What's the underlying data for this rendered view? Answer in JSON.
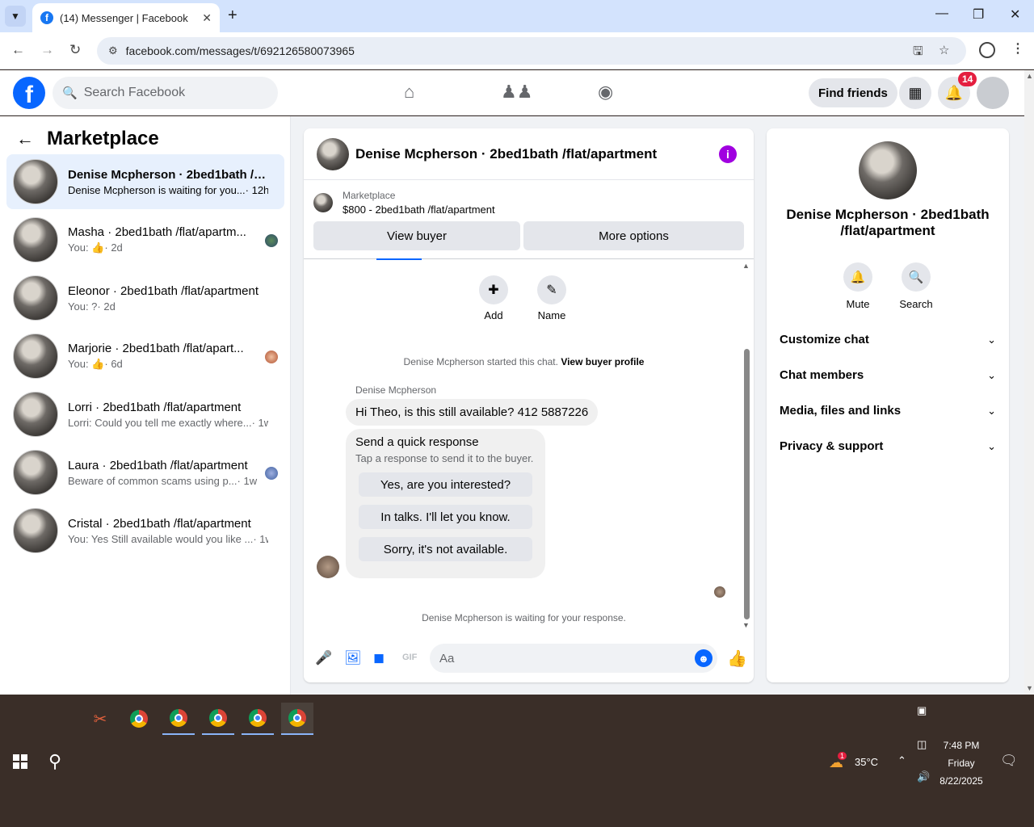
{
  "browser": {
    "tab_title": "(14) Messenger | Facebook",
    "url": "facebook.com/messages/t/692126580073965"
  },
  "fb": {
    "search_placeholder": "Search Facebook",
    "find_friends": "Find friends",
    "notification_count": "14"
  },
  "left": {
    "title": "Marketplace",
    "conversations": [
      {
        "name": "Denise Mcpherson · 2bed1bath /fl...",
        "preview": "Denise Mcpherson is waiting for you...",
        "time": "· 12h",
        "active": true
      },
      {
        "name": "Masha · 2bed1bath /flat/apartm...",
        "preview": "You:",
        "time": "· 2d",
        "like": true
      },
      {
        "name": "Eleonor · 2bed1bath /flat/apartment",
        "preview": "You: ?",
        "time": "· 2d"
      },
      {
        "name": "Marjorie · 2bed1bath /flat/apart...",
        "preview": "You:",
        "time": "· 6d",
        "like": true
      },
      {
        "name": "Lorri · 2bed1bath /flat/apartment",
        "preview": "Lorri: Could you tell me exactly where...",
        "time": "· 1w"
      },
      {
        "name": "Laura · 2bed1bath /flat/apartment",
        "preview": "Beware of common scams using p...",
        "time": "· 1w"
      },
      {
        "name": "Cristal · 2bed1bath /flat/apartment",
        "preview": "You: Yes Still available would you like ...",
        "time": "· 1w"
      }
    ]
  },
  "chat": {
    "title": "Denise Mcpherson · 2bed1bath /flat/apartment",
    "marketplace_label": "Marketplace",
    "listing": "$800 - 2bed1bath /flat/apartment",
    "view_buyer": "View buyer",
    "more_options": "More options",
    "add_label": "Add",
    "name_label": "Name",
    "started_text": "Denise Mcpherson started this chat.",
    "view_profile": "View buyer profile",
    "sender": "Denise Mcpherson",
    "message": "Hi Theo, is this still available? 412 5887226",
    "quick_title": "Send a quick response",
    "quick_sub": "Tap a response to send it to the buyer.",
    "quick_options": [
      "Yes, are you interested?",
      "In talks. I'll let you know.",
      "Sorry, it's not available."
    ],
    "waiting": "Denise Mcpherson is waiting for your response.",
    "input_placeholder": "Aa"
  },
  "right": {
    "name": "Denise Mcpherson · 2bed1bath /flat/apartment",
    "mute": "Mute",
    "search": "Search",
    "sections": [
      "Customize chat",
      "Chat members",
      "Media, files and links",
      "Privacy & support"
    ]
  },
  "taskbar": {
    "weather": "35°C",
    "weather_badge": "1",
    "time": "7:48 PM",
    "day": "Friday",
    "date": "8/22/2025"
  }
}
